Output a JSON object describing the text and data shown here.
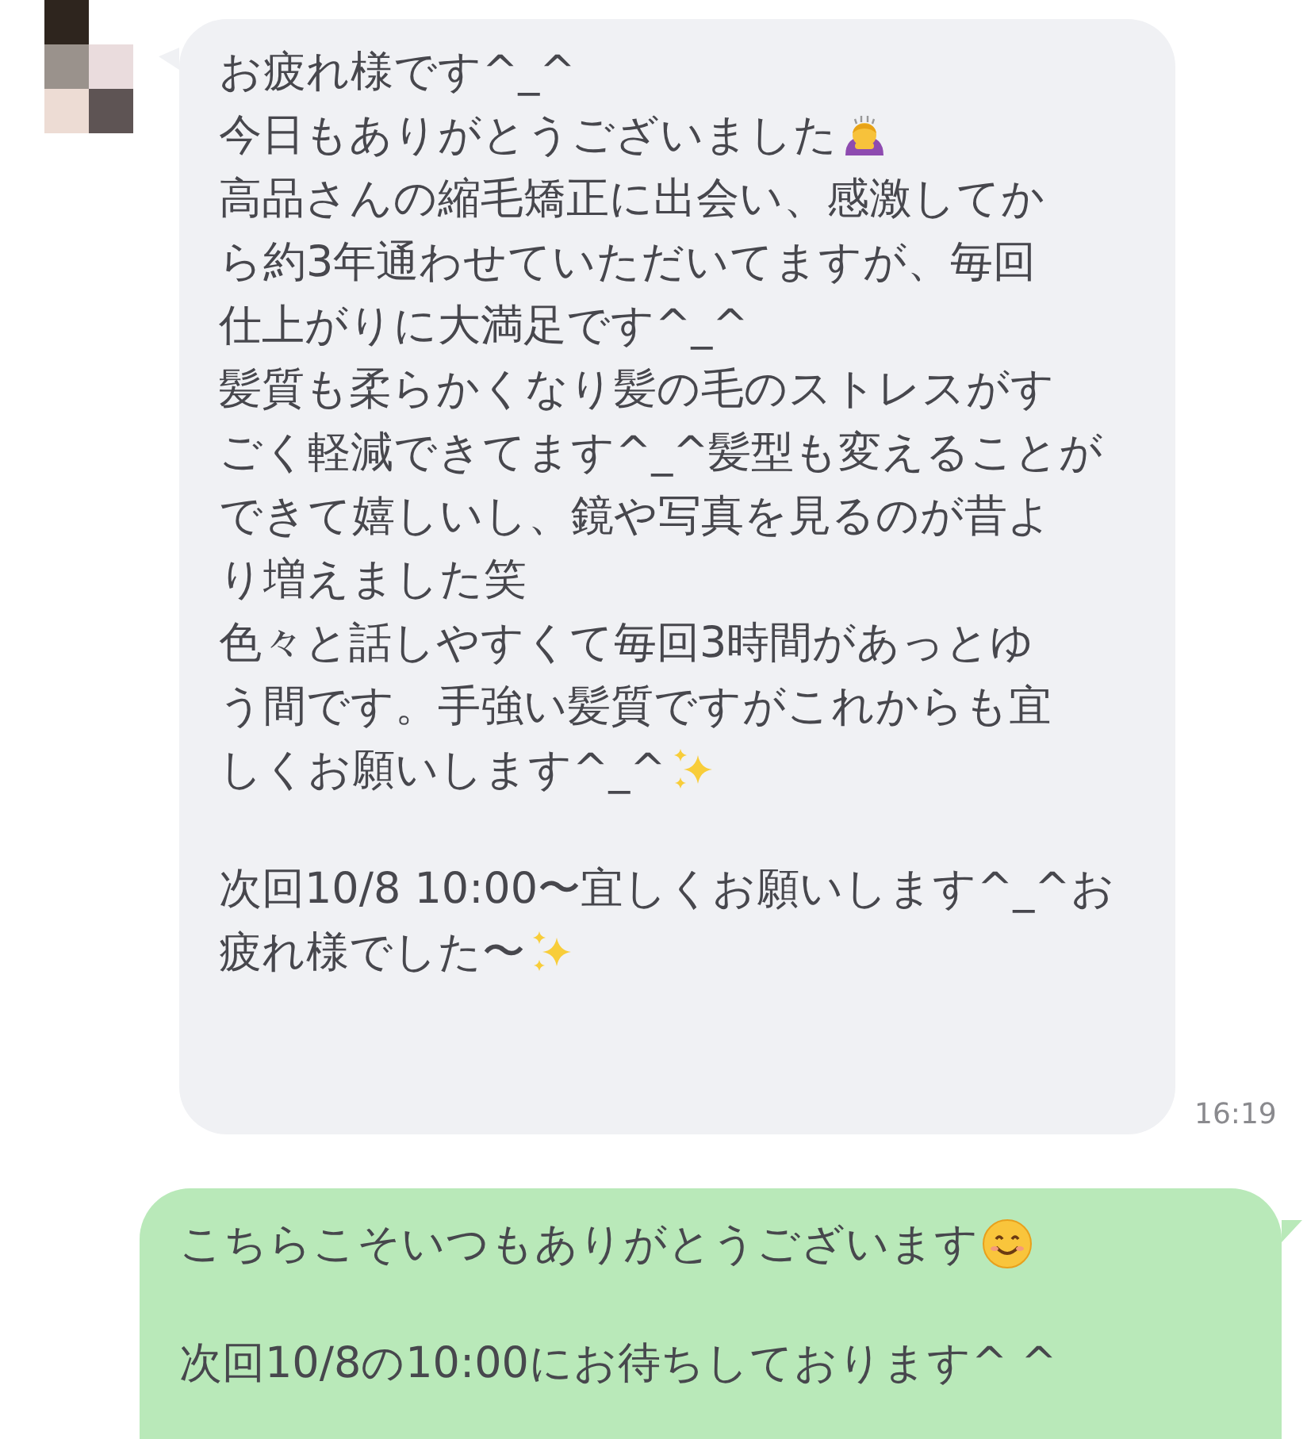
{
  "messages": [
    {
      "kind": "incoming",
      "time": "16:19",
      "paragraphs": [
        [
          {
            "kind": "plain",
            "text": "お疲れ様です^_^"
          },
          {
            "kind": "bowing",
            "text": "今日もありがとうございました"
          },
          {
            "kind": "plain",
            "text": "高品さんの縮毛矯正に出会い、感激してか"
          },
          {
            "kind": "plain",
            "text": "ら約3年通わせていただいてますが、毎回"
          },
          {
            "kind": "plain",
            "text": "仕上がりに大満足です^_^"
          },
          {
            "kind": "plain",
            "text": "髪質も柔らかくなり髪の毛のストレスがす"
          },
          {
            "kind": "plain",
            "text": "ごく軽減できてます^_^髪型も変えることが"
          },
          {
            "kind": "plain",
            "text": "できて嬉しいし、鏡や写真を見るのが昔よ"
          },
          {
            "kind": "plain",
            "text": "り増えました笑"
          },
          {
            "kind": "plain",
            "text": "色々と話しやすくて毎回3時間があっとゆ"
          },
          {
            "kind": "plain",
            "text": "う間です。手強い髪質ですがこれからも宜"
          },
          {
            "kind": "sparkles",
            "text": "しくお願いします^_^"
          }
        ],
        [
          {
            "kind": "plain",
            "text": "次回10/8 10:00〜宜しくお願いします^_^お"
          },
          {
            "kind": "sparkles",
            "text": "疲れ様でした〜"
          }
        ]
      ]
    },
    {
      "kind": "outgoing",
      "paragraphs": [
        [
          {
            "kind": "smile",
            "text": "こちらこそいつもありがとうございます"
          }
        ],
        [
          {
            "kind": "plain",
            "text": "次回10/8の10:00にお待ちしております^ ^"
          }
        ]
      ]
    }
  ]
}
